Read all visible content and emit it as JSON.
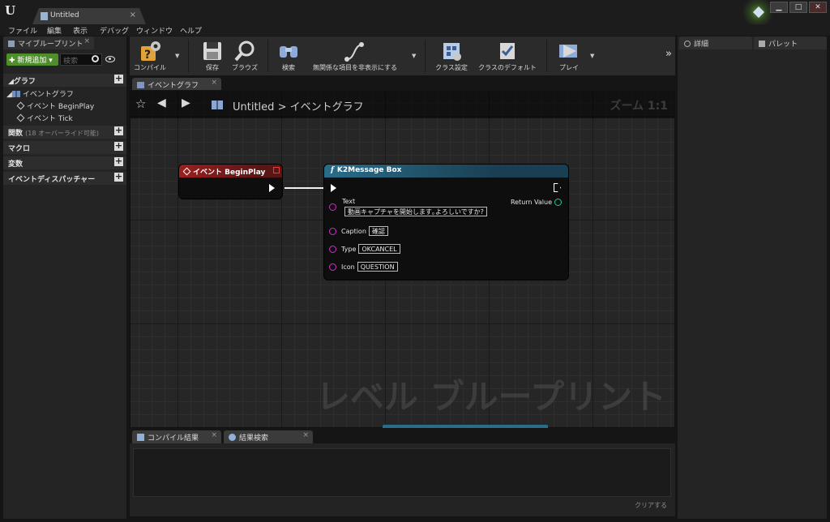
{
  "window": {
    "tab_title": "Untitled",
    "tab_close": "×",
    "buttons": {
      "minimize": "▁",
      "maximize": "□",
      "close": "✕"
    }
  },
  "menu": [
    "ファイル",
    "編集",
    "表示",
    "デバッグ",
    "ウィンドウ",
    "ヘルプ"
  ],
  "my_blueprint": {
    "tab_label": "マイブループリント",
    "add_new_label": "新規追加",
    "search_placeholder": "検索",
    "sections": {
      "graphs": "グラフ",
      "functions": "関数",
      "functions_sub": "(18 オーバーライド可能)",
      "macros": "マクロ",
      "variables": "変数",
      "event_dispatchers": "イベントディスパッチャー"
    },
    "tree": {
      "event_graph": "イベントグラフ",
      "begin_play": "イベント BeginPlay",
      "tick": "イベント Tick"
    }
  },
  "toolbar": {
    "compile": "コンパイル",
    "save": "保存",
    "browse": "ブラウズ",
    "search": "検索",
    "hide_unrelated": "無関係な項目を非表示にする",
    "class_settings": "クラス設定",
    "class_defaults": "クラスのデフォルト",
    "play": "プレイ"
  },
  "graph": {
    "tab_label": "イベントグラフ",
    "breadcrumb_root": "Untitled",
    "breadcrumb_sep": ">",
    "breadcrumb_leaf": "イベントグラフ",
    "zoom": "ズーム 1:1",
    "watermark": "レベル ブループリント",
    "event_node_title": "イベント BeginPlay",
    "func_node_title": "K2Message Box",
    "pins": {
      "text_label": "Text",
      "text_value": "動画キャプチャを開始します｡よろしいですか?",
      "caption_label": "Caption",
      "caption_value": "確認",
      "type_label": "Type",
      "type_value": "OKCANCEL",
      "icon_label": "Icon",
      "icon_value": "QUESTION",
      "return_label": "Return Value"
    }
  },
  "bottom": {
    "compile_results_tab": "コンパイル結果",
    "find_results_tab": "結果検索",
    "clear_label": "クリアする"
  },
  "right": {
    "details_tab": "詳細",
    "palette_tab": "パレット"
  }
}
